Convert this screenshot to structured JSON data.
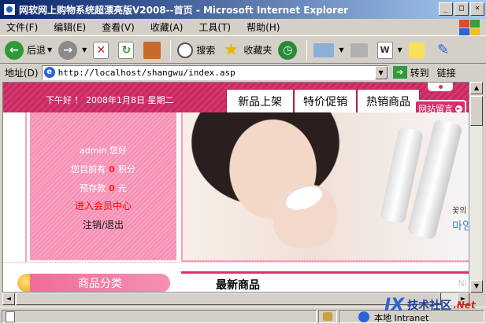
{
  "window": {
    "title": "网软网上购物系统超漂亮版V2008--首页 - Microsoft Internet Explorer",
    "min": "_",
    "max": "□",
    "close": "×"
  },
  "menu": [
    "文件(F)",
    "编辑(E)",
    "查看(V)",
    "收藏(A)",
    "工具(T)",
    "帮助(H)"
  ],
  "toolbar": {
    "back": "后退",
    "search": "搜索",
    "favorites": "收藏夹"
  },
  "address": {
    "label": "地址(D)",
    "url": "http://localhost/shangwu/index.asp",
    "go": "转到",
    "links": "链接"
  },
  "page": {
    "greeting": "下午好 ！ 2008年1月8日 星期二",
    "tabs": [
      "新品上架",
      "特价促销",
      "热销商品"
    ],
    "guestbook": "网站留言",
    "user": {
      "name_line": "admin 您好",
      "points_prefix": "您目前有",
      "points": "0",
      "points_suffix": "积分",
      "deposit_prefix": "预存款",
      "deposit": "0",
      "deposit_suffix": "元",
      "member_center": "进入会员中心",
      "logout": "注销/退出"
    },
    "banner": {
      "text1": "꽃의",
      "text2": "마임"
    },
    "category_header": "商品分类",
    "new_products": "最新商品",
    "new_products_tag": "NI"
  },
  "status": {
    "zone": "本地 Intranet"
  },
  "watermark": {
    "logo": "IX",
    "brand": "技术社区",
    "net": ".Net"
  },
  "colors": {
    "header_pink": "#d23870",
    "panel_pink": "#f7a3c2",
    "accent_red": "#ff0000",
    "title_blue": "#0a246a"
  }
}
